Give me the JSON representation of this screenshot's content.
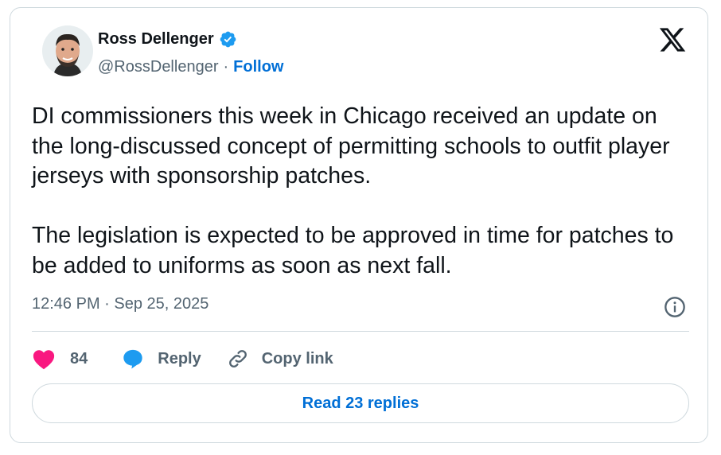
{
  "author": {
    "name": "Ross Dellenger",
    "handle": "@RossDellenger",
    "separator": "·",
    "follow_label": "Follow",
    "verified": true,
    "avatar_icon": "avatar-illustration"
  },
  "brand": {
    "logo_icon": "x-logo-icon"
  },
  "tweet": {
    "text": "DI commissioners this week in Chicago received an update on the long-discussed concept of permitting schools to outfit player jerseys with sponsorship patches.\n\nThe legislation is expected to be approved in time for patches to be added to uniforms as soon as next fall.",
    "timestamp": "12:46 PM · Sep 25, 2025"
  },
  "actions": {
    "like_count": "84",
    "reply_label": "Reply",
    "copy_label": "Copy link",
    "read_replies_label": "Read 23 replies"
  },
  "colors": {
    "accent": "#006fd6",
    "verified": "#1d9bf0",
    "like": "#f91880",
    "reply_icon": "#1d9bf0",
    "muted": "#536471",
    "border": "#cfd9de"
  }
}
